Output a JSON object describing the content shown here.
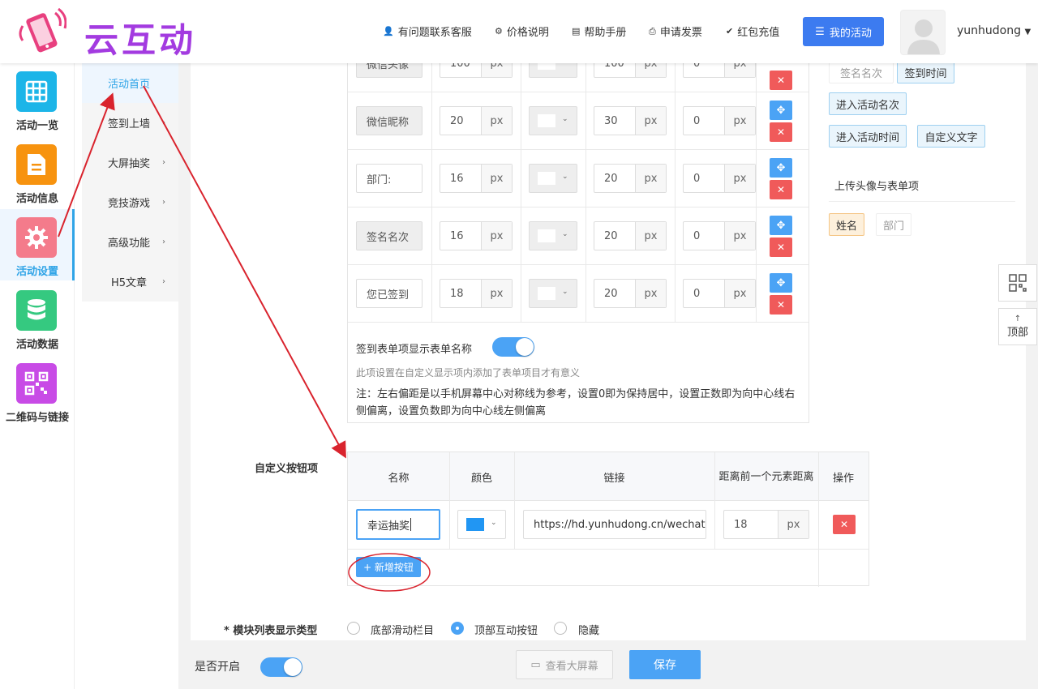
{
  "app": {
    "logo_text": "云互动",
    "username": "yunhudong"
  },
  "header_nav": [
    {
      "label": "有问题联系客服",
      "icon": "user-plus-icon"
    },
    {
      "label": "价格说明",
      "icon": "gear-icon"
    },
    {
      "label": "帮助手册",
      "icon": "book-icon"
    },
    {
      "label": "申请发票",
      "icon": "printer-icon"
    },
    {
      "label": "红包充值",
      "icon": "shield-check-icon"
    }
  ],
  "my_activity": "我的活动",
  "sidebar": {
    "items": [
      {
        "label": "活动一览",
        "color": "#1cb5e8",
        "icon": "grid-icon"
      },
      {
        "label": "活动信息",
        "color": "#f7930f",
        "icon": "document-icon"
      },
      {
        "label": "活动设置",
        "color": "#f47b8b",
        "icon": "gear-icon"
      },
      {
        "label": "活动数据",
        "color": "#35c980",
        "icon": "database-icon"
      },
      {
        "label": "二维码与链接",
        "color": "#c84be6",
        "icon": "qrcode-icon"
      }
    ]
  },
  "subnav": {
    "items": [
      {
        "label": "活动首页"
      },
      {
        "label": "签到上墙"
      },
      {
        "label": "大屏抽奖"
      },
      {
        "label": "竞技游戏"
      },
      {
        "label": "高级功能"
      },
      {
        "label": "H5文章"
      }
    ]
  },
  "field_table": {
    "unit": "px",
    "rows": [
      {
        "label": "微信头像",
        "size": "100",
        "line_height": "100",
        "offset": "0"
      },
      {
        "label": "微信昵称",
        "size": "20",
        "line_height": "30",
        "offset": "0"
      },
      {
        "label": "部门:",
        "size": "16",
        "line_height": "20",
        "offset": "0"
      },
      {
        "label": "签名名次",
        "size": "16",
        "line_height": "20",
        "offset": "0"
      },
      {
        "label": "您已签到",
        "size": "18",
        "line_height": "20",
        "offset": "0"
      }
    ],
    "show_form_name_label": "签到表单项显示表单名称",
    "hint": "此项设置在自定义显示项内添加了表单项目才有意义",
    "note": "注：左右偏距是以手机屏幕中心对称线为参考，设置0即为保持居中，设置正数即为向中心线右侧偏离，设置负数即为向中心线左侧偏离"
  },
  "right_panel": {
    "tags_top": [
      "签名名次",
      "签到时间",
      "进入活动名次",
      "进入活动时间",
      "自定义文字"
    ],
    "upload_title": "上传头像与表单项",
    "upload_tags": [
      "姓名",
      "部门"
    ]
  },
  "float_buttons": {
    "top_label": "顶部"
  },
  "custom_buttons": {
    "section_label": "自定义按钮项",
    "headers": [
      "名称",
      "颜色",
      "链接",
      "距离前一个元素距离",
      "操作"
    ],
    "row": {
      "name": "幸运抽奖",
      "color": "#2196f3",
      "link": "https://hd.yunhudong.cn/wechat",
      "distance": "18",
      "unit": "px"
    },
    "add_label": "+ 新增按钮"
  },
  "module_type": {
    "label": "* 模块列表显示类型",
    "options": [
      "底部滑动栏目",
      "顶部互动按钮",
      "隐藏"
    ],
    "selected": 1
  },
  "footer": {
    "enable_label": "是否开启",
    "preview_label": "查看大屏幕",
    "save_label": "保存"
  }
}
